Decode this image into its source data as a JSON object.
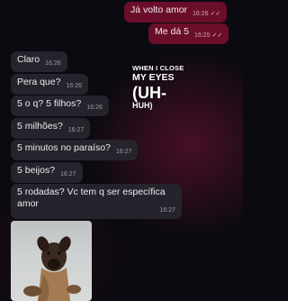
{
  "messages": [
    {
      "text": "Já volto amor",
      "time": "16:26",
      "ticks": "✓✓"
    },
    {
      "text": "Me dá 5",
      "time": "16:25",
      "ticks": "✓✓"
    },
    {
      "text": "Claro",
      "time": "16:26"
    },
    {
      "text": "Pera que?",
      "time": "16:26"
    },
    {
      "text": "5 o q? 5 filhos?",
      "time": "16:26"
    },
    {
      "text": "5 milhões?",
      "time": "16:27"
    },
    {
      "text": "5 minutos no paraíso?",
      "time": "16:27"
    },
    {
      "text": "5 beijos?",
      "time": "16:27"
    },
    {
      "text": "5 rodadas? Vc tem q ser específica amor",
      "time": "16:27"
    }
  ],
  "overlay": {
    "line1": "WHEN I CLOSE",
    "line2": "MY EYES",
    "line3": "(UH-",
    "line4": "HUH)"
  },
  "photo": {
    "subject": "dog-photo"
  }
}
